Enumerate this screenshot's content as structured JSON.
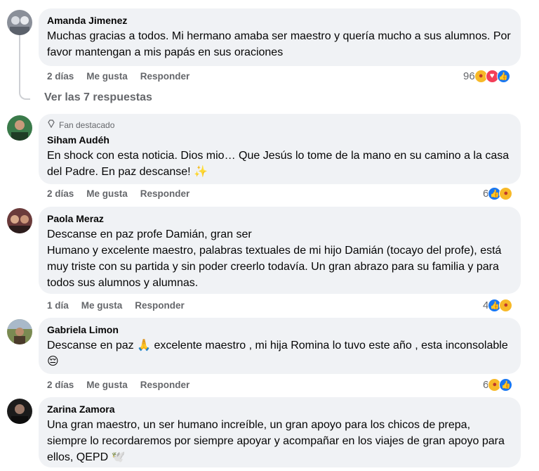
{
  "comments": [
    {
      "author": "Amanda Jimenez",
      "text": "Muchas gracias a todos. Mi hermano amaba ser maestro y quería mucho a sus alumnos. Por favor mantengan a mis papás en sus oraciones",
      "time": "2 días",
      "like_label": "Me gusta",
      "reply_label": "Responder",
      "reaction_count": "96",
      "reactions": [
        "care-icon",
        "love-icon",
        "like-icon"
      ]
    },
    {
      "badge": "Fan destacado",
      "author": "Siham Audéh",
      "text": "En shock con esta noticia. Dios mio… Que Jesús lo tome de la mano en su camino a la casa del Padre. En paz descanse! ✨",
      "time": "2 días",
      "like_label": "Me gusta",
      "reply_label": "Responder",
      "reaction_count": "6",
      "reactions": [
        "like-icon",
        "care-icon"
      ]
    },
    {
      "author": "Paola Meraz",
      "text": "Descanse en paz profe Damián, gran ser\nHumano y excelente maestro, palabras textuales de mi hijo Damián (tocayo del profe), está muy triste con su partida y sin poder creerlo todavía. Un gran abrazo para su familia y para todos sus alumnos y alumnas.",
      "time": "1 día",
      "like_label": "Me gusta",
      "reply_label": "Responder",
      "reaction_count": "4",
      "reactions": [
        "like-icon",
        "care-icon"
      ]
    },
    {
      "author": "Gabriela Limon",
      "text": "Descanse en paz 🙏 excelente maestro , mi hija Romina lo tuvo este año , esta inconsolable 😔",
      "time": "2 días",
      "like_label": "Me gusta",
      "reply_label": "Responder",
      "reaction_count": "6",
      "reactions": [
        "care-icon",
        "like-icon"
      ]
    },
    {
      "author": "Zarina Zamora",
      "text": "Una gran maestro, un ser humano increíble, un gran apoyo para los chicos de prepa, siempre lo recordaremos por siempre apoyar y acompañar en los viajes de gran apoyo para ellos, QEPD 🕊️"
    }
  ],
  "replies_link": "Ver las 7 respuestas"
}
